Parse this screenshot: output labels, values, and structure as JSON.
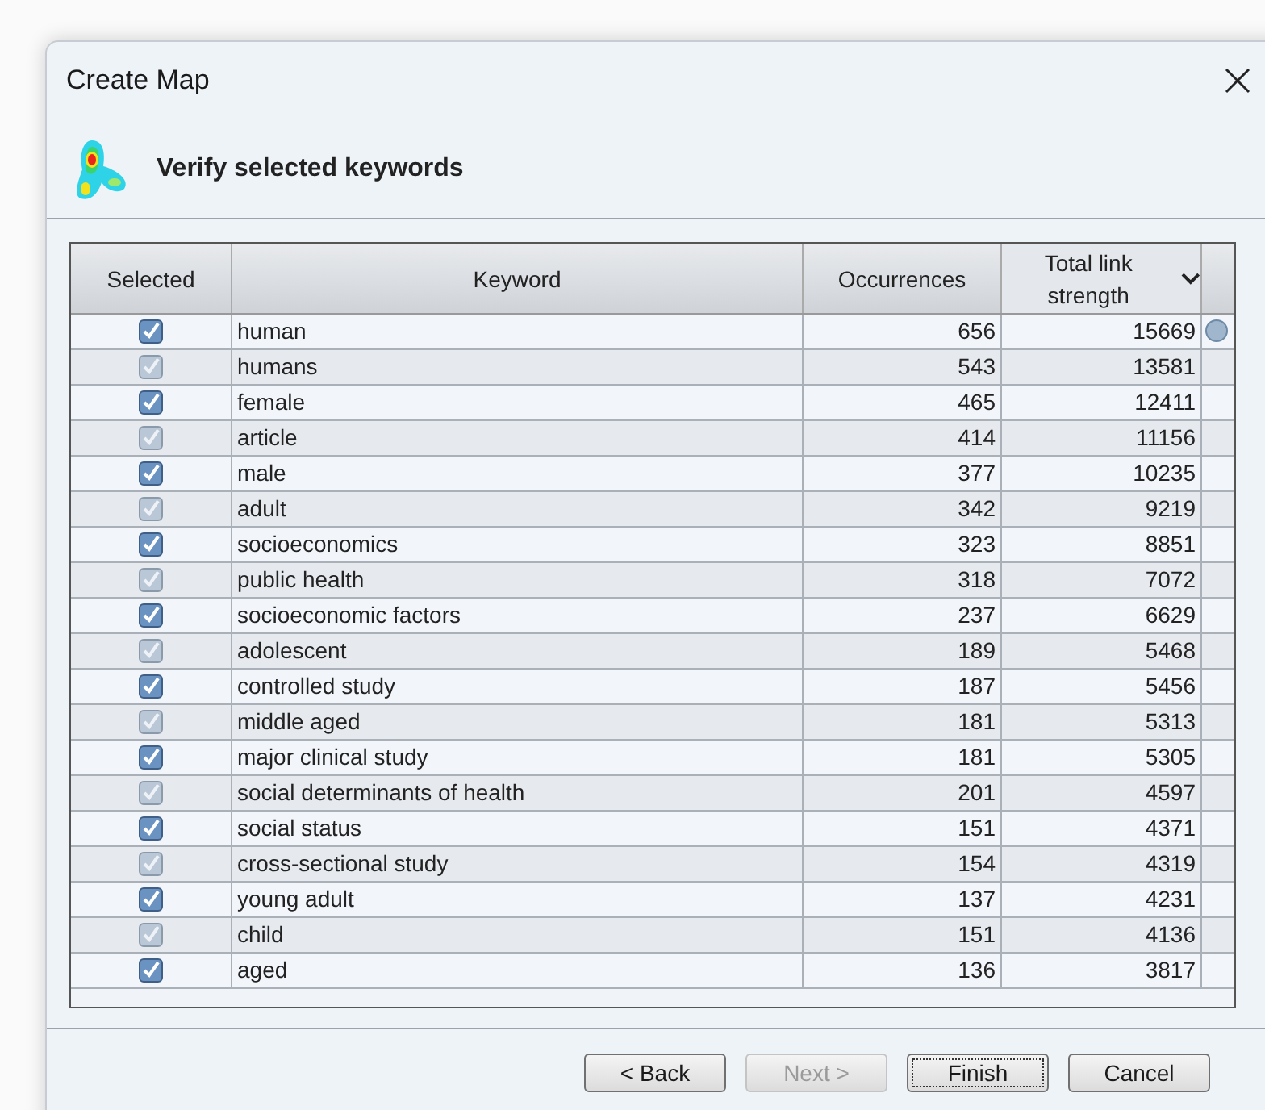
{
  "window": {
    "title": "Create Map"
  },
  "header": {
    "title": "Verify selected keywords"
  },
  "table": {
    "columns": [
      {
        "label": "Selected",
        "sorted": false
      },
      {
        "label": "Keyword",
        "sorted": false
      },
      {
        "label": "Occurrences",
        "sorted": false
      },
      {
        "label": "Total link strength",
        "sorted": true
      }
    ],
    "rows": [
      {
        "checked": true,
        "keyword": "human",
        "occurrences": "656",
        "strength": "15669"
      },
      {
        "checked": true,
        "keyword": "humans",
        "occurrences": "543",
        "strength": "13581"
      },
      {
        "checked": true,
        "keyword": "female",
        "occurrences": "465",
        "strength": "12411"
      },
      {
        "checked": true,
        "keyword": "article",
        "occurrences": "414",
        "strength": "11156"
      },
      {
        "checked": true,
        "keyword": "male",
        "occurrences": "377",
        "strength": "10235"
      },
      {
        "checked": true,
        "keyword": "adult",
        "occurrences": "342",
        "strength": "9219"
      },
      {
        "checked": true,
        "keyword": "socioeconomics",
        "occurrences": "323",
        "strength": "8851"
      },
      {
        "checked": true,
        "keyword": "public health",
        "occurrences": "318",
        "strength": "7072"
      },
      {
        "checked": true,
        "keyword": "socioeconomic factors",
        "occurrences": "237",
        "strength": "6629"
      },
      {
        "checked": true,
        "keyword": "adolescent",
        "occurrences": "189",
        "strength": "5468"
      },
      {
        "checked": true,
        "keyword": "controlled study",
        "occurrences": "187",
        "strength": "5456"
      },
      {
        "checked": true,
        "keyword": "middle aged",
        "occurrences": "181",
        "strength": "5313"
      },
      {
        "checked": true,
        "keyword": "major clinical study",
        "occurrences": "181",
        "strength": "5305"
      },
      {
        "checked": true,
        "keyword": "social determinants of health",
        "occurrences": "201",
        "strength": "4597"
      },
      {
        "checked": true,
        "keyword": "social status",
        "occurrences": "151",
        "strength": "4371"
      },
      {
        "checked": true,
        "keyword": "cross-sectional study",
        "occurrences": "154",
        "strength": "4319"
      },
      {
        "checked": true,
        "keyword": "young adult",
        "occurrences": "137",
        "strength": "4231"
      },
      {
        "checked": true,
        "keyword": "child",
        "occurrences": "151",
        "strength": "4136"
      },
      {
        "checked": true,
        "keyword": "aged",
        "occurrences": "136",
        "strength": "3817"
      }
    ]
  },
  "buttons": [
    {
      "label": "< Back",
      "disabled": false,
      "default": false
    },
    {
      "label": "Next >",
      "disabled": true,
      "default": false
    },
    {
      "label": "Finish",
      "disabled": false,
      "default": true
    },
    {
      "label": "Cancel",
      "disabled": false,
      "default": false
    }
  ]
}
